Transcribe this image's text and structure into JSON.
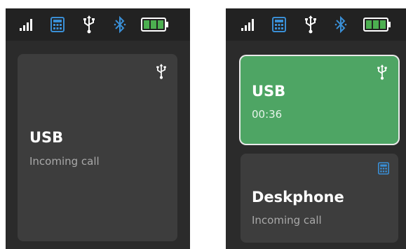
{
  "colors": {
    "background": "#2b2b2b",
    "statusbar": "#222222",
    "card": "#3d3d3d",
    "active_card": "#4ea564",
    "accent_blue": "#3a8fd6",
    "battery_green": "#4caf50"
  },
  "statusbar_icons": [
    "signal-icon",
    "deskphone-icon",
    "usb-icon",
    "bluetooth-icon",
    "battery-icon"
  ],
  "left_screen": {
    "card": {
      "title": "USB",
      "subtitle": "Incoming call",
      "icon": "usb-icon"
    }
  },
  "right_screen": {
    "cards": [
      {
        "title": "USB",
        "subtitle": "00:36",
        "icon": "usb-icon",
        "active": true
      },
      {
        "title": "Deskphone",
        "subtitle": "Incoming call",
        "icon": "deskphone-icon",
        "active": false
      }
    ]
  }
}
